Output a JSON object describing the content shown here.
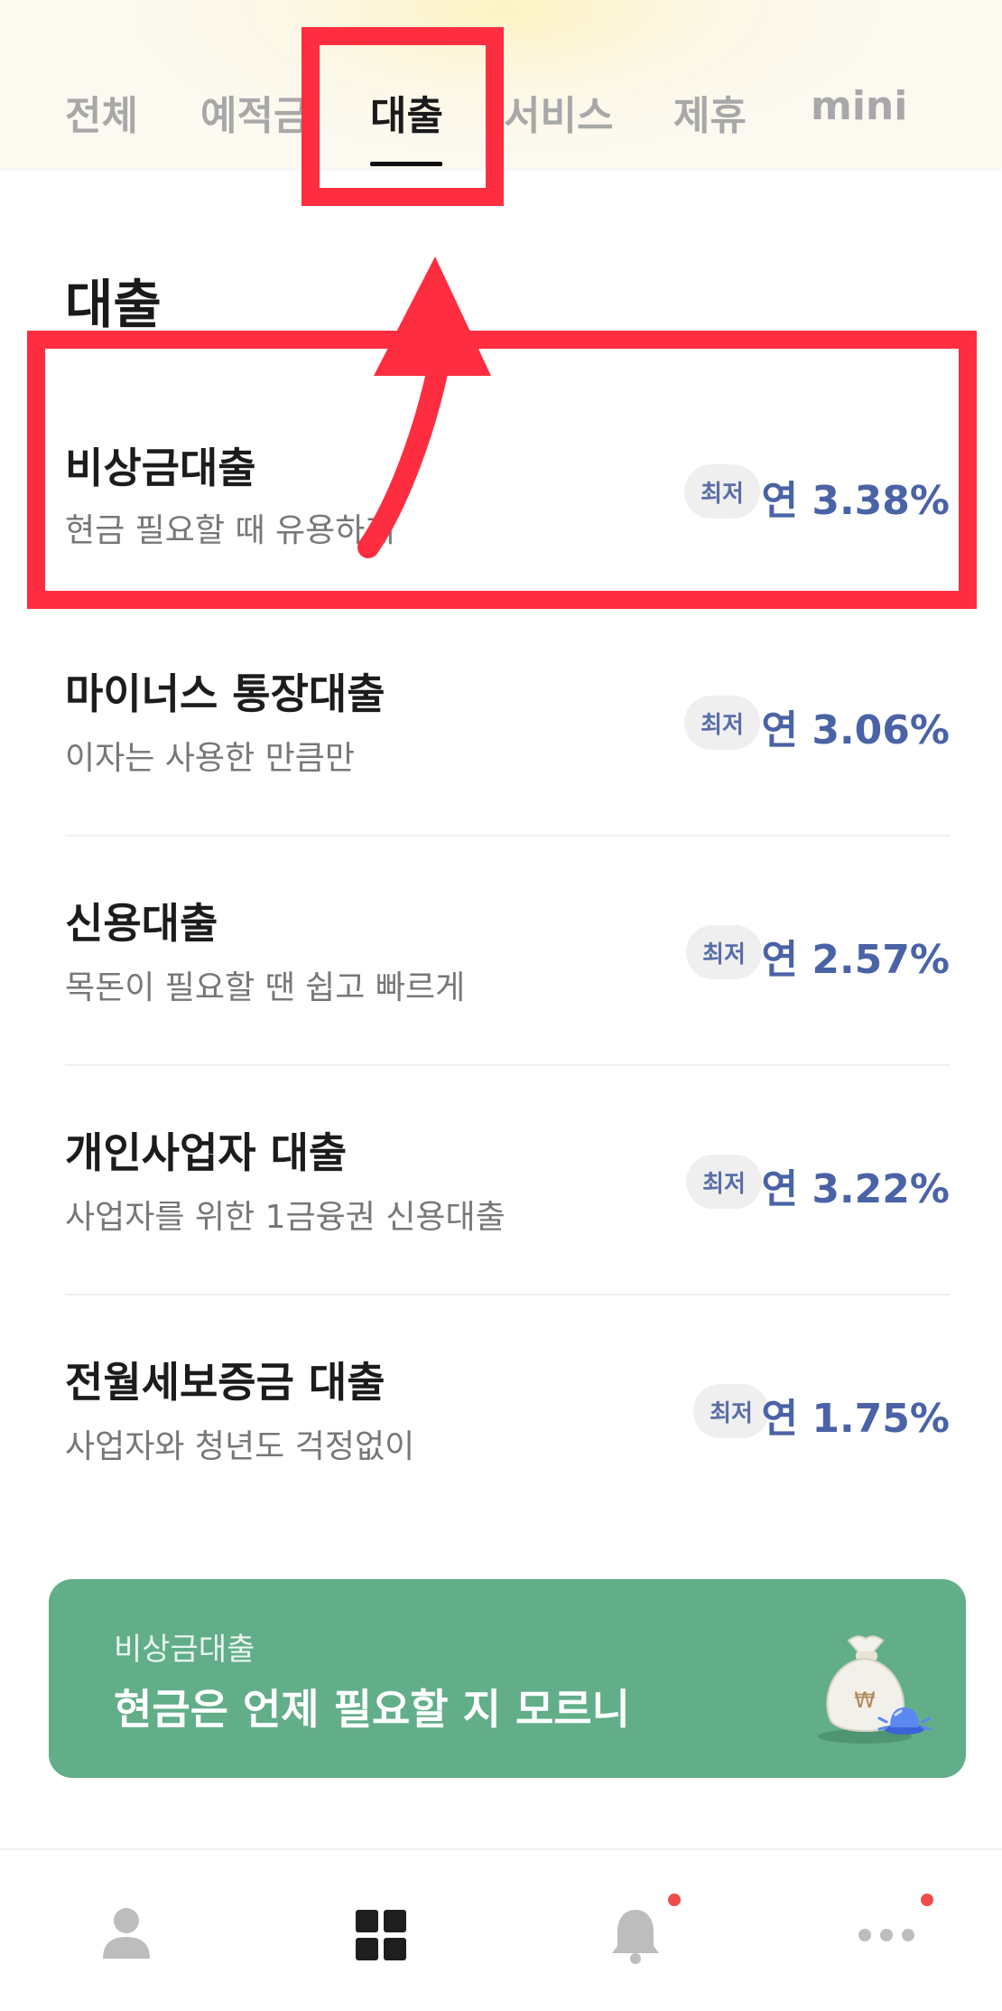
{
  "tabs": [
    {
      "label": "전체"
    },
    {
      "label": "예적금"
    },
    {
      "label": "대출"
    },
    {
      "label": "서비스"
    },
    {
      "label": "제휴"
    },
    {
      "label": "mini"
    }
  ],
  "active_tab": "대출",
  "section": {
    "title": "대출"
  },
  "loans": [
    {
      "name": "비상금대출",
      "desc": "현금 필요할 때 유용하게",
      "badge": "최저",
      "rate": "연 3.38%"
    },
    {
      "name": "마이너스 통장대출",
      "desc": "이자는 사용한 만큼만",
      "badge": "최저",
      "rate": "연 3.06%"
    },
    {
      "name": "신용대출",
      "desc": "목돈이 필요할 땐 쉽고 빠르게",
      "badge": "최저",
      "rate": "연 2.57%"
    },
    {
      "name": "개인사업자 대출",
      "desc": "사업자를 위한 1금융권 신용대출",
      "badge": "최저",
      "rate": "연 3.22%"
    },
    {
      "name": "전월세보증금 대출",
      "desc": "사업자와 청년도 걱정없이",
      "badge": "최저",
      "rate": "연 1.75%"
    }
  ],
  "banner": {
    "subtitle": "비상금대출",
    "title": "현금은 언제 필요할 지 모르니",
    "icon": "money-bag-with-siren-icon",
    "currency_symbol": "₩"
  },
  "bottom_nav": [
    {
      "icon": "person-icon",
      "badge": false
    },
    {
      "icon": "grid-icon",
      "badge": false,
      "active": true
    },
    {
      "icon": "bell-icon",
      "badge": true
    },
    {
      "icon": "more-icon",
      "badge": true
    }
  ],
  "colors": {
    "accent_rate": "#4a63a6",
    "banner_bg": "#62ae89",
    "annotation": "#ff2d40",
    "notification_dot": "#ef4d4d"
  }
}
